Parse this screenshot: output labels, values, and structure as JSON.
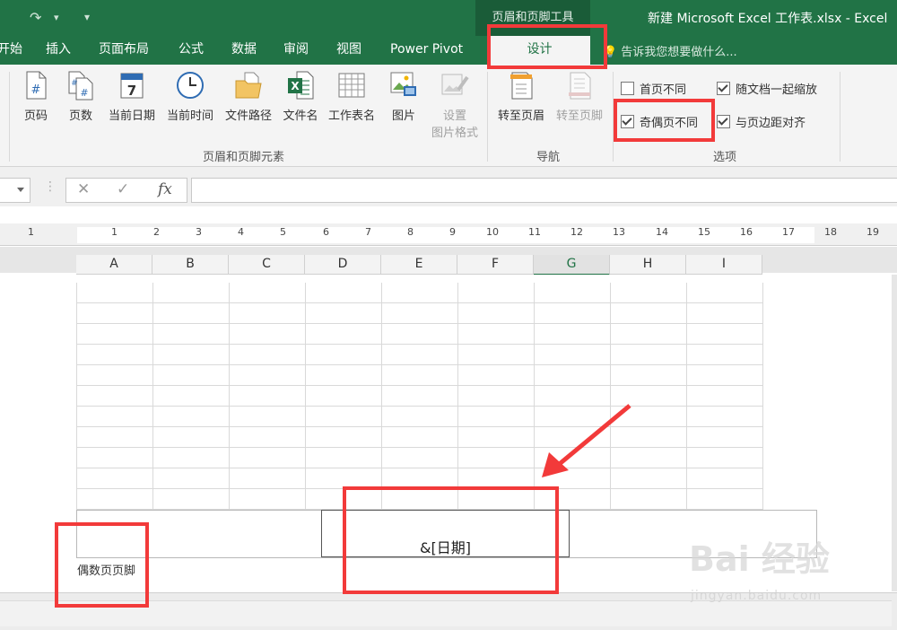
{
  "titlebar": {
    "context_tab_group": "页眉和页脚工具",
    "window_title": "新建 Microsoft Excel 工作表.xlsx - Excel"
  },
  "tabs": [
    {
      "label": "开始"
    },
    {
      "label": "插入"
    },
    {
      "label": "页面布局"
    },
    {
      "label": "公式"
    },
    {
      "label": "数据"
    },
    {
      "label": "审阅"
    },
    {
      "label": "视图"
    },
    {
      "label": "Power Pivot"
    }
  ],
  "active_tab": "设计",
  "tell_me": "告诉我您想要做什么...",
  "ribbon": {
    "elements_group": {
      "label": "页眉和页脚元素",
      "buttons": [
        {
          "label": "页码",
          "icon": "page-number-icon"
        },
        {
          "label": "页数",
          "icon": "page-count-icon"
        },
        {
          "label": "当前日期",
          "icon": "calendar-icon"
        },
        {
          "label": "当前时间",
          "icon": "clock-icon"
        },
        {
          "label": "文件路径",
          "icon": "folder-icon"
        },
        {
          "label": "文件名",
          "icon": "excel-file-icon"
        },
        {
          "label": "工作表名",
          "icon": "sheet-grid-icon"
        },
        {
          "label": "图片",
          "icon": "picture-icon"
        },
        {
          "label": "设置",
          "label2": "图片格式",
          "icon": "format-picture-icon",
          "disabled": true
        }
      ]
    },
    "navigation_group": {
      "label": "导航",
      "buttons": [
        {
          "label": "转至页眉",
          "icon": "goto-header-icon"
        },
        {
          "label": "转至页脚",
          "icon": "goto-footer-icon",
          "disabled": true
        }
      ]
    },
    "options_group": {
      "label": "选项",
      "options": [
        {
          "label": "首页不同",
          "checked": false
        },
        {
          "label": "随文档一起缩放",
          "checked": true
        },
        {
          "label": "奇偶页不同",
          "checked": true
        },
        {
          "label": "与页边距对齐",
          "checked": true
        }
      ]
    }
  },
  "formula_bar": {
    "fx": "fx",
    "value": ""
  },
  "ruler": {
    "numbers": [
      "1",
      "1",
      "2",
      "3",
      "4",
      "5",
      "6",
      "7",
      "8",
      "9",
      "10",
      "11",
      "12",
      "13",
      "14",
      "15",
      "16",
      "17",
      "18",
      "19"
    ]
  },
  "columns": [
    "A",
    "B",
    "C",
    "D",
    "E",
    "F",
    "G",
    "H",
    "I"
  ],
  "selected_column": "G",
  "footer": {
    "center_text": "&[日期]",
    "label": "偶数页页脚"
  },
  "watermark": {
    "logo": "Bai 经验",
    "url": "jingyan.baidu.com"
  },
  "colors": {
    "excel_green": "#217346",
    "annotation_red": "#f23a3a"
  }
}
